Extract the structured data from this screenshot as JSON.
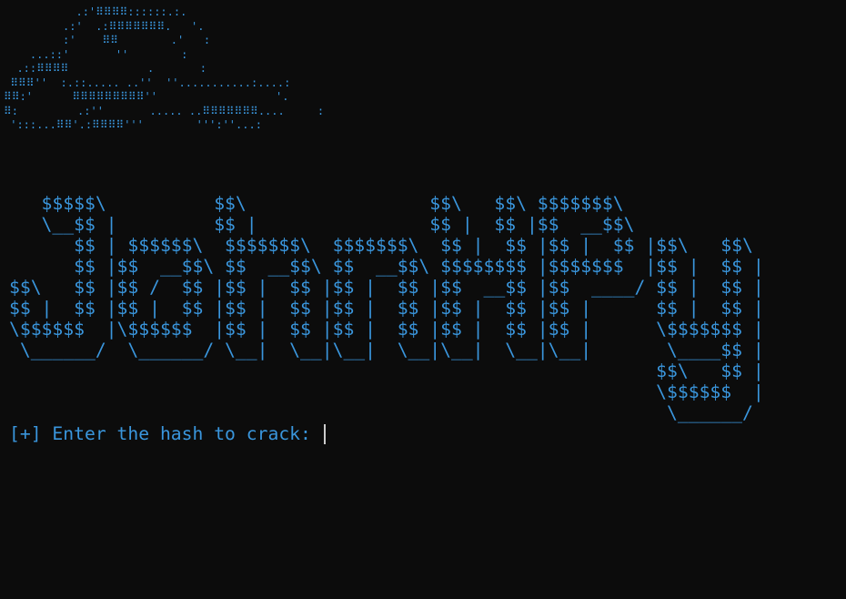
{
  "terminal": {
    "hat_art": "           .:'⠿⠿⠿⠿::::::.:.\n         .:'  .:⠿⠿⠿⠿⠿⠿⠿.   '.\n         :'    ⠿⠿        .'   :\n    ...::'       ''        :\n  .::⠿⠿⠿⠿            .       :\n ⠿⠿⠿''  :.::..... ..''  ''...........:....:\n⠿⠿:'      ⠿⠿⠿⠿⠿⠿⠿⠿⠿''                  '.\n⠿:         .:''       ..... ..⠿⠿⠿⠿⠿⠿⠿....     :\n ':::...⠿⠿'.:⠿⠿⠿⠿'''        ''':''...:",
    "banner_art": "   $$$$$\\          $$\\                 $$\\   $$\\ $$$$$$$\\\n   \\__$$ |         $$ |                $$ |  $$ |$$  __$$\\\n      $$ | $$$$$$\\  $$$$$$$\\  $$$$$$$\\  $$ |  $$ |$$ |  $$ |$$\\   $$\\\n      $$ |$$  __$$\\ $$  __$$\\ $$  __$$\\ $$$$$$$$ |$$$$$$$  |$$ |  $$ |\n$$\\   $$ |$$ /  $$ |$$ |  $$ |$$ |  $$ |$$  __$$ |$$  ____/ $$ |  $$ |\n$$ |  $$ |$$ |  $$ |$$ |  $$ |$$ |  $$ |$$ |  $$ |$$ |      $$ |  $$ |\n\\$$$$$$  |\\$$$$$$  |$$ |  $$ |$$ |  $$ |$$ |  $$ |$$ |      \\$$$$$$$ |\n \\______/  \\______/ \\__|  \\__|\\__|  \\__|\\__|  \\__|\\__|       \\____$$ |\n                                                            $$\\   $$ |\n                                                            \\$$$$$$  |\n                                                             \\______/",
    "prompt": "[+] Enter the hash to crack: ",
    "input_value": ""
  },
  "colors": {
    "background": "#0c0c0c",
    "text": "#3a96dd",
    "cursor": "#cccccc"
  }
}
